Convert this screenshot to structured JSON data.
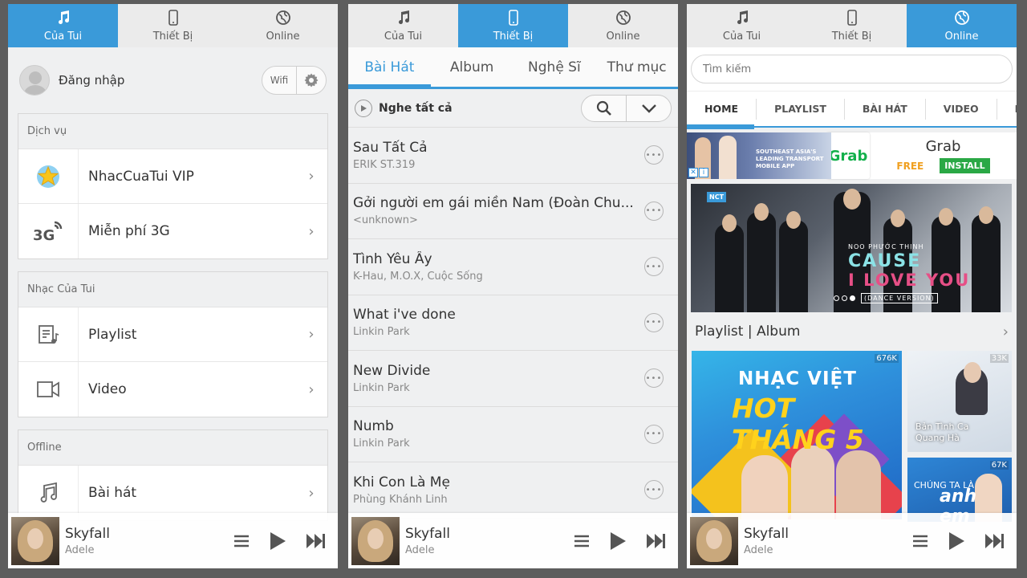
{
  "tabs": {
    "cua_tui": "Của Tui",
    "thiet_bi": "Thiết Bị",
    "online": "Online"
  },
  "panel1": {
    "login_label": "Đăng nhập",
    "wifi_label": "Wifi",
    "sections": [
      {
        "header": "Dịch vụ",
        "items": [
          {
            "label": "NhacCuaTui VIP",
            "icon": "vip-star-icon"
          },
          {
            "label": "Miễn phí 3G",
            "icon": "3g-icon"
          }
        ]
      },
      {
        "header": "Nhạc Của Tui",
        "items": [
          {
            "label": "Playlist",
            "icon": "playlist-icon"
          },
          {
            "label": "Video",
            "icon": "video-icon"
          }
        ]
      },
      {
        "header": "Offline",
        "items": [
          {
            "label": "Bài hát",
            "icon": "music-note-icon"
          }
        ]
      }
    ]
  },
  "panel2": {
    "subtabs": [
      "Bài Hát",
      "Album",
      "Nghệ Sĩ",
      "Thư mục"
    ],
    "play_all": "Nghe tất cả",
    "songs": [
      {
        "title": "Sau Tất Cả",
        "artist": "ERIK ST.319"
      },
      {
        "title": "Gởi người em gái miền Nam (Đoàn Chu...",
        "artist": "<unknown>"
      },
      {
        "title": "Tình Yêu Ấy",
        "artist": "K-Hau, M.O.X, Cuộc Sống"
      },
      {
        "title": "What i've done",
        "artist": "Linkin Park"
      },
      {
        "title": "New Divide",
        "artist": "Linkin Park"
      },
      {
        "title": "Numb",
        "artist": "Linkin Park"
      },
      {
        "title": "Khi Con Là Mẹ",
        "artist": "Phùng Khánh Linh"
      }
    ]
  },
  "panel3": {
    "search_placeholder": "Tìm kiếm",
    "nav": [
      "HOME",
      "PLAYLIST",
      "BÀI HÁT",
      "VIDEO",
      "BX"
    ],
    "ad": {
      "line1": "SOUTHEAST ASIA'S",
      "line2": "LEADING TRANSPORT",
      "line3": "MOBILE APP",
      "logo": "Grab",
      "name": "Grab",
      "free": "FREE",
      "install": "INSTALL"
    },
    "banner": {
      "badge": "NCT",
      "artist": "NOO PHƯỚC THỊNH",
      "line1": "CAUSE",
      "line2": "I LOVE YOU",
      "version": "(DANCE VERSION)"
    },
    "section_title": "Playlist | Album",
    "tiles": {
      "big": {
        "count": "676K",
        "line1": "NHẠC VIỆT",
        "line2": "HOT THÁNG 5"
      },
      "small1": {
        "count": "33K",
        "line1": "Bản Tình Ca",
        "line2": "Quang Hà"
      },
      "small2": {
        "count": "67K",
        "line1": "CHÚNG TA LÀ",
        "line2": "anh em"
      }
    }
  },
  "player": {
    "title": "Skyfall",
    "artist": "Adele"
  },
  "colors": {
    "accent": "#3a9ad9",
    "background": "#eff0f1",
    "frame": "#5d5d5d"
  }
}
